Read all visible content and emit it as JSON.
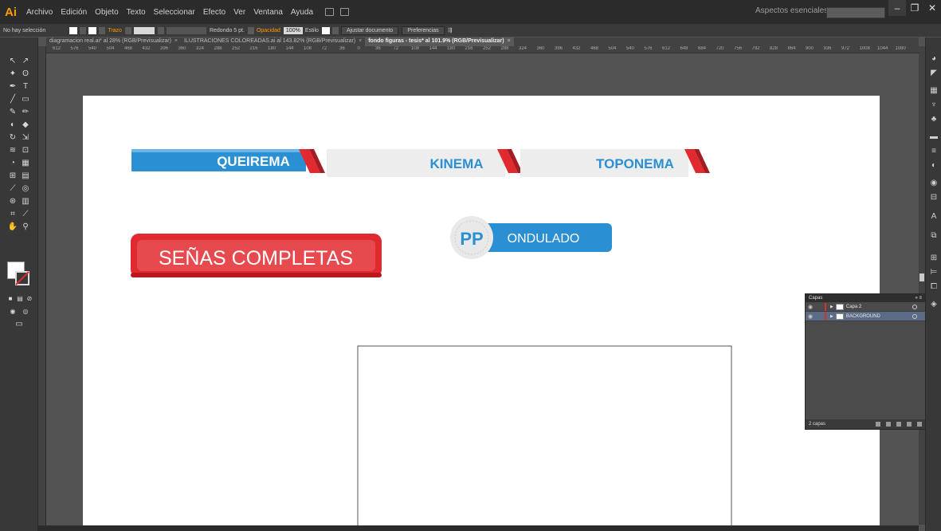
{
  "app": {
    "logo": "Ai"
  },
  "menu": [
    "Archivo",
    "Edición",
    "Objeto",
    "Texto",
    "Seleccionar",
    "Efecto",
    "Ver",
    "Ventana",
    "Ayuda"
  ],
  "workspace": "Aspectos esenciales",
  "controlbar": {
    "selection": "No hay selección",
    "stroke_label": "Trazo",
    "brush": "Redondo 5 pt.",
    "opacity_label": "Opacidad",
    "opacity_value": "100%",
    "style_label": "Estilo",
    "fit_button": "Ajustar documento",
    "prefs_button": "Preferencias"
  },
  "tabs": [
    {
      "label": "diagramacion real.ai* al 28% (RGB/Previsualizar)",
      "active": false
    },
    {
      "label": "ILUSTRACIONES COLOREADAS.ai al 143.82% (RGB/Previsualizar)",
      "active": false
    },
    {
      "label": "fondo figuras - tesis* al 101.9% (RGB/Previsualizar)",
      "active": true
    }
  ],
  "ruler_top": [
    "612",
    "576",
    "540",
    "504",
    "468",
    "432",
    "396",
    "360",
    "324",
    "288",
    "252",
    "216",
    "180",
    "144",
    "108",
    "72",
    "36",
    "0",
    "36",
    "72",
    "108",
    "144",
    "180",
    "216",
    "252",
    "288",
    "324",
    "360",
    "396",
    "432",
    "468",
    "504",
    "540",
    "576",
    "612",
    "648",
    "684",
    "720",
    "756",
    "792",
    "828",
    "864",
    "900",
    "936",
    "972",
    "1008",
    "1044",
    "1080"
  ],
  "artwork": {
    "banners": [
      "QUEIREMA",
      "KINEMA",
      "TOPONEMA"
    ],
    "senas": "SEÑAS COMPLETAS",
    "pp_badge": "PP",
    "pp_label": "ONDULADO"
  },
  "colors": {
    "blue": "#2a8fd3",
    "red": "#e12a2f",
    "light_gray": "#ededed"
  },
  "layers_panel": {
    "title": "Capas",
    "layers": [
      {
        "name": "Capa 2",
        "selected": false
      },
      {
        "name": "BACKGROUND",
        "selected": true
      }
    ],
    "count": "2 capas"
  }
}
